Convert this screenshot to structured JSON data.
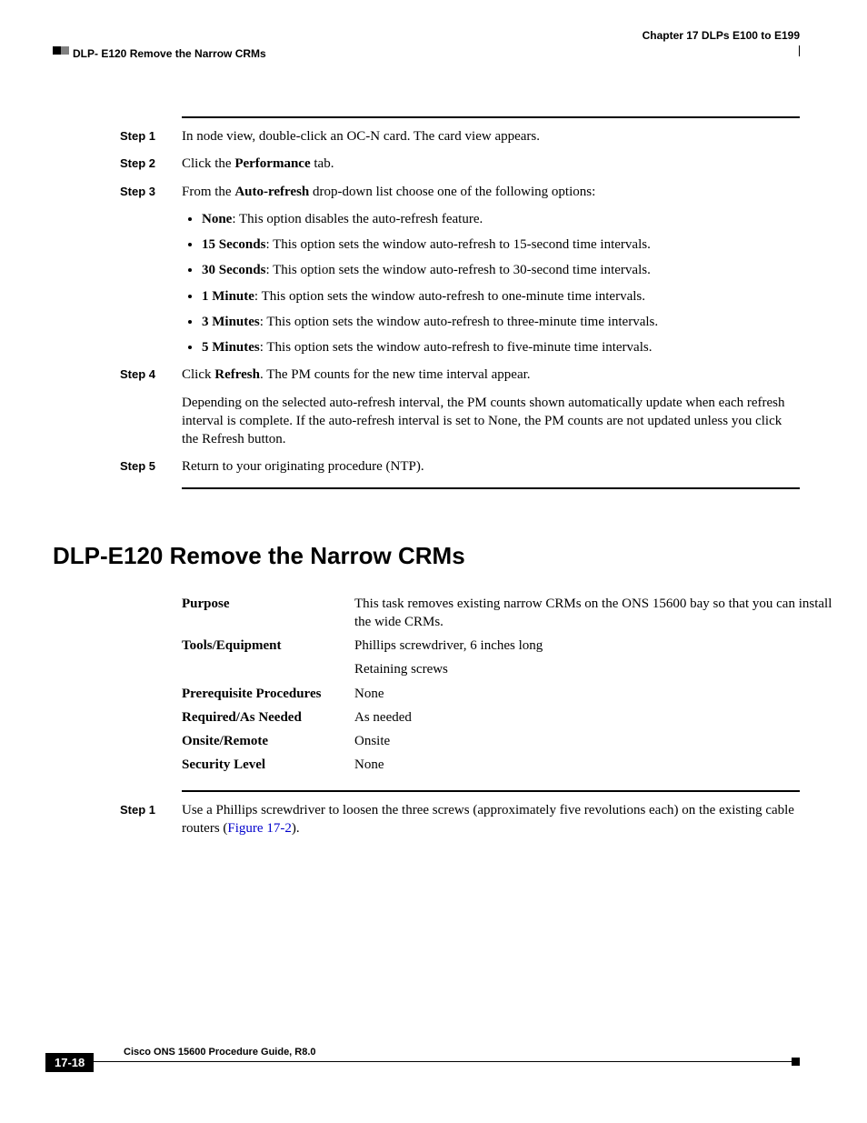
{
  "header": {
    "chapter": "Chapter 17      DLPs E100 to E199",
    "section": "DLP- E120 Remove the Narrow CRMs"
  },
  "procA": {
    "step1": {
      "label": "Step 1",
      "text_pre": "In node view, double-click an OC-N card. The card view appears."
    },
    "step2": {
      "label": "Step 2",
      "text_a": "Click the ",
      "bold": "Performance",
      "text_b": " tab."
    },
    "step3": {
      "label": "Step 3",
      "text_a": "From the ",
      "bold": "Auto-refresh",
      "text_b": " drop-down list choose one of the following options:",
      "bullets": [
        {
          "b": "None",
          "rest": ": This option disables the auto-refresh feature."
        },
        {
          "b": "15 Seconds",
          "rest": ": This option sets the window auto-refresh to 15-second time intervals."
        },
        {
          "b": "30 Seconds",
          "rest": ": This option sets the window auto-refresh to 30-second time intervals."
        },
        {
          "b": "1 Minute",
          "rest": ": This option sets the window auto-refresh to one-minute time intervals."
        },
        {
          "b": "3 Minutes",
          "rest": ": This option sets the window auto-refresh to three-minute time intervals."
        },
        {
          "b": "5 Minutes",
          "rest": ": This option sets the window auto-refresh to five-minute time intervals."
        }
      ]
    },
    "step4": {
      "label": "Step 4",
      "line1_a": "Click ",
      "line1_bold": "Refresh",
      "line1_b": ". The PM counts for the new time interval appear.",
      "para2": "Depending on the selected auto-refresh interval, the PM counts shown automatically update when each refresh interval is complete. If the auto-refresh interval is set to None, the PM counts are not updated unless you click the Refresh button."
    },
    "step5": {
      "label": "Step 5",
      "text": "Return to your originating procedure (NTP)."
    }
  },
  "heading": "DLP-E120 Remove the Narrow CRMs",
  "info": {
    "rows": [
      {
        "label": "Purpose",
        "value": "This task removes existing narrow CRMs on the ONS 15600 bay so that you can install the wide CRMs."
      },
      {
        "label": "Tools/Equipment",
        "value": "Phillips screwdriver, 6 inches long"
      },
      {
        "label": "",
        "value": "Retaining screws"
      },
      {
        "label": "Prerequisite Procedures",
        "value": "None"
      },
      {
        "label": "Required/As Needed",
        "value": "As needed"
      },
      {
        "label": "Onsite/Remote",
        "value": "Onsite"
      },
      {
        "label": "Security Level",
        "value": "None"
      }
    ]
  },
  "procB": {
    "step1": {
      "label": "Step 1",
      "text_a": "Use a Phillips screwdriver to loosen the three screws (approximately five revolutions each) on the existing cable routers (",
      "link": "Figure 17-2",
      "text_b": ")."
    }
  },
  "footer": {
    "title": "Cisco ONS 15600 Procedure Guide, R8.0",
    "page": "17-18"
  }
}
